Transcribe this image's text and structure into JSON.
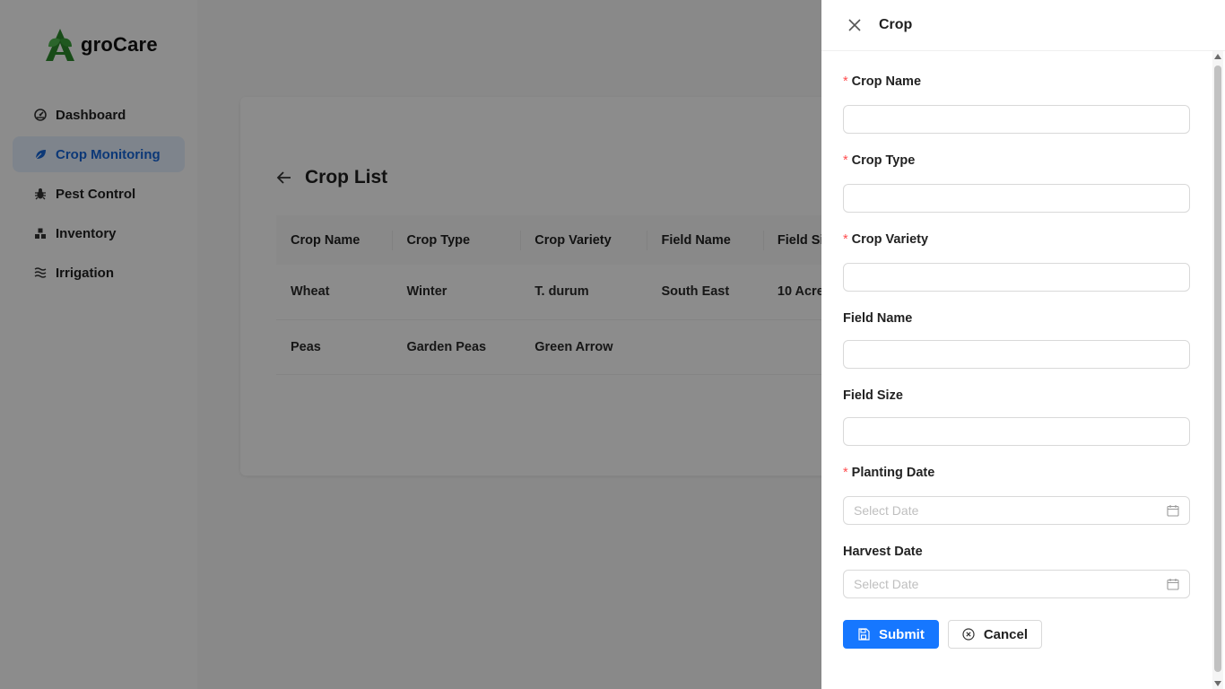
{
  "app": {
    "name": "groCare"
  },
  "sidebar": {
    "items": [
      {
        "label": "Dashboard",
        "icon": "dashboard-gauge-icon",
        "active": false
      },
      {
        "label": "Crop Monitoring",
        "icon": "leaf-icon",
        "active": true
      },
      {
        "label": "Pest Control",
        "icon": "bug-icon",
        "active": false
      },
      {
        "label": "Inventory",
        "icon": "boxes-icon",
        "active": false
      },
      {
        "label": "Irrigation",
        "icon": "water-waves-icon",
        "active": false
      }
    ]
  },
  "main": {
    "title": "Crop List",
    "table": {
      "headers": [
        "Crop Name",
        "Crop Type",
        "Crop Variety",
        "Field Name",
        "Field Size"
      ],
      "rows": [
        [
          "Wheat",
          "Winter",
          "T. durum",
          "South East",
          "10 Acre"
        ],
        [
          "Peas",
          "Garden Peas",
          "Green Arrow",
          "",
          ""
        ]
      ]
    }
  },
  "drawer": {
    "title": "Crop",
    "fields": [
      {
        "label": "Crop Name",
        "required": true,
        "type": "text",
        "value": ""
      },
      {
        "label": "Crop Type",
        "required": true,
        "type": "text",
        "value": ""
      },
      {
        "label": "Crop Variety",
        "required": true,
        "type": "text",
        "value": ""
      },
      {
        "label": "Field Name",
        "required": false,
        "type": "text",
        "value": ""
      },
      {
        "label": "Field Size",
        "required": false,
        "type": "text",
        "value": ""
      },
      {
        "label": "Planting Date",
        "required": true,
        "type": "date",
        "placeholder": "Select Date"
      },
      {
        "label": "Harvest Date",
        "required": false,
        "type": "date",
        "placeholder": "Select Date"
      }
    ],
    "submit_label": "Submit",
    "cancel_label": "Cancel"
  },
  "colors": {
    "primary": "#1677ff",
    "active_nav_bg": "#e6f0ff",
    "active_nav_text": "#1667d9",
    "required_asterisk": "#ff4d4f",
    "logo_green": "#3aa13a"
  }
}
